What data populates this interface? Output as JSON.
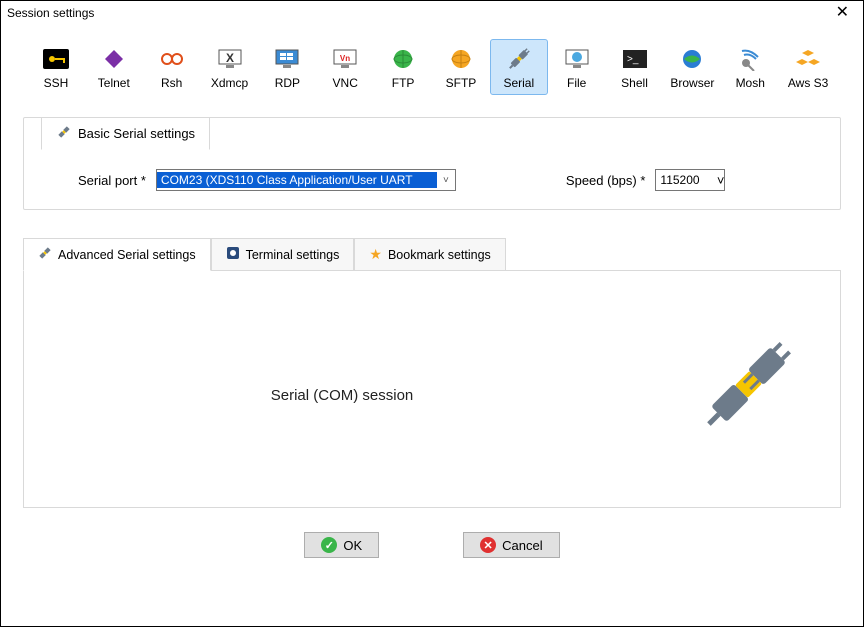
{
  "window": {
    "title": "Session settings"
  },
  "session_types": [
    {
      "id": "ssh",
      "label": "SSH"
    },
    {
      "id": "telnet",
      "label": "Telnet"
    },
    {
      "id": "rsh",
      "label": "Rsh"
    },
    {
      "id": "xdmcp",
      "label": "Xdmcp"
    },
    {
      "id": "rdp",
      "label": "RDP"
    },
    {
      "id": "vnc",
      "label": "VNC"
    },
    {
      "id": "ftp",
      "label": "FTP"
    },
    {
      "id": "sftp",
      "label": "SFTP"
    },
    {
      "id": "serial",
      "label": "Serial",
      "selected": true
    },
    {
      "id": "file",
      "label": "File"
    },
    {
      "id": "shell",
      "label": "Shell"
    },
    {
      "id": "browser",
      "label": "Browser"
    },
    {
      "id": "mosh",
      "label": "Mosh"
    },
    {
      "id": "awss3",
      "label": "Aws S3"
    }
  ],
  "basic_tab": {
    "label": "Basic Serial settings"
  },
  "fields": {
    "port_label": "Serial port *",
    "port_value": "COM23  (XDS110 Class Application/User UART",
    "speed_label": "Speed (bps) *",
    "speed_value": "115200"
  },
  "tabs2": [
    {
      "id": "adv",
      "label": "Advanced Serial settings",
      "icon": "plug",
      "active": true
    },
    {
      "id": "term",
      "label": "Terminal settings",
      "icon": "gear"
    },
    {
      "id": "book",
      "label": "Bookmark settings",
      "icon": "star"
    }
  ],
  "lower_panel": {
    "heading": "Serial (COM) session"
  },
  "buttons": {
    "ok": "OK",
    "cancel": "Cancel"
  }
}
